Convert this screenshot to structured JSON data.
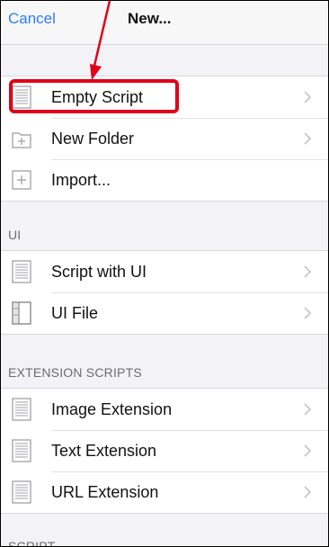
{
  "navbar": {
    "cancel_label": "Cancel",
    "title": "New..."
  },
  "sections": {
    "ui_header": "UI",
    "ext_header": "EXTENSION SCRIPTS",
    "cut_header": "SCRIPT"
  },
  "items": {
    "empty_script": "Empty Script",
    "new_folder": "New Folder",
    "import": "Import...",
    "script_with_ui": "Script with UI",
    "ui_file": "UI File",
    "image_extension": "Image Extension",
    "text_extension": "Text Extension",
    "url_extension": "URL Extension"
  },
  "icons": {
    "script": "document-lines-icon",
    "folder": "folder-plus-icon",
    "import": "plus-square-icon",
    "uifile": "ui-layout-icon",
    "chevron": "chevron-right-icon"
  },
  "colors": {
    "accent": "#2f7cf6",
    "annotation": "#e0001a"
  }
}
